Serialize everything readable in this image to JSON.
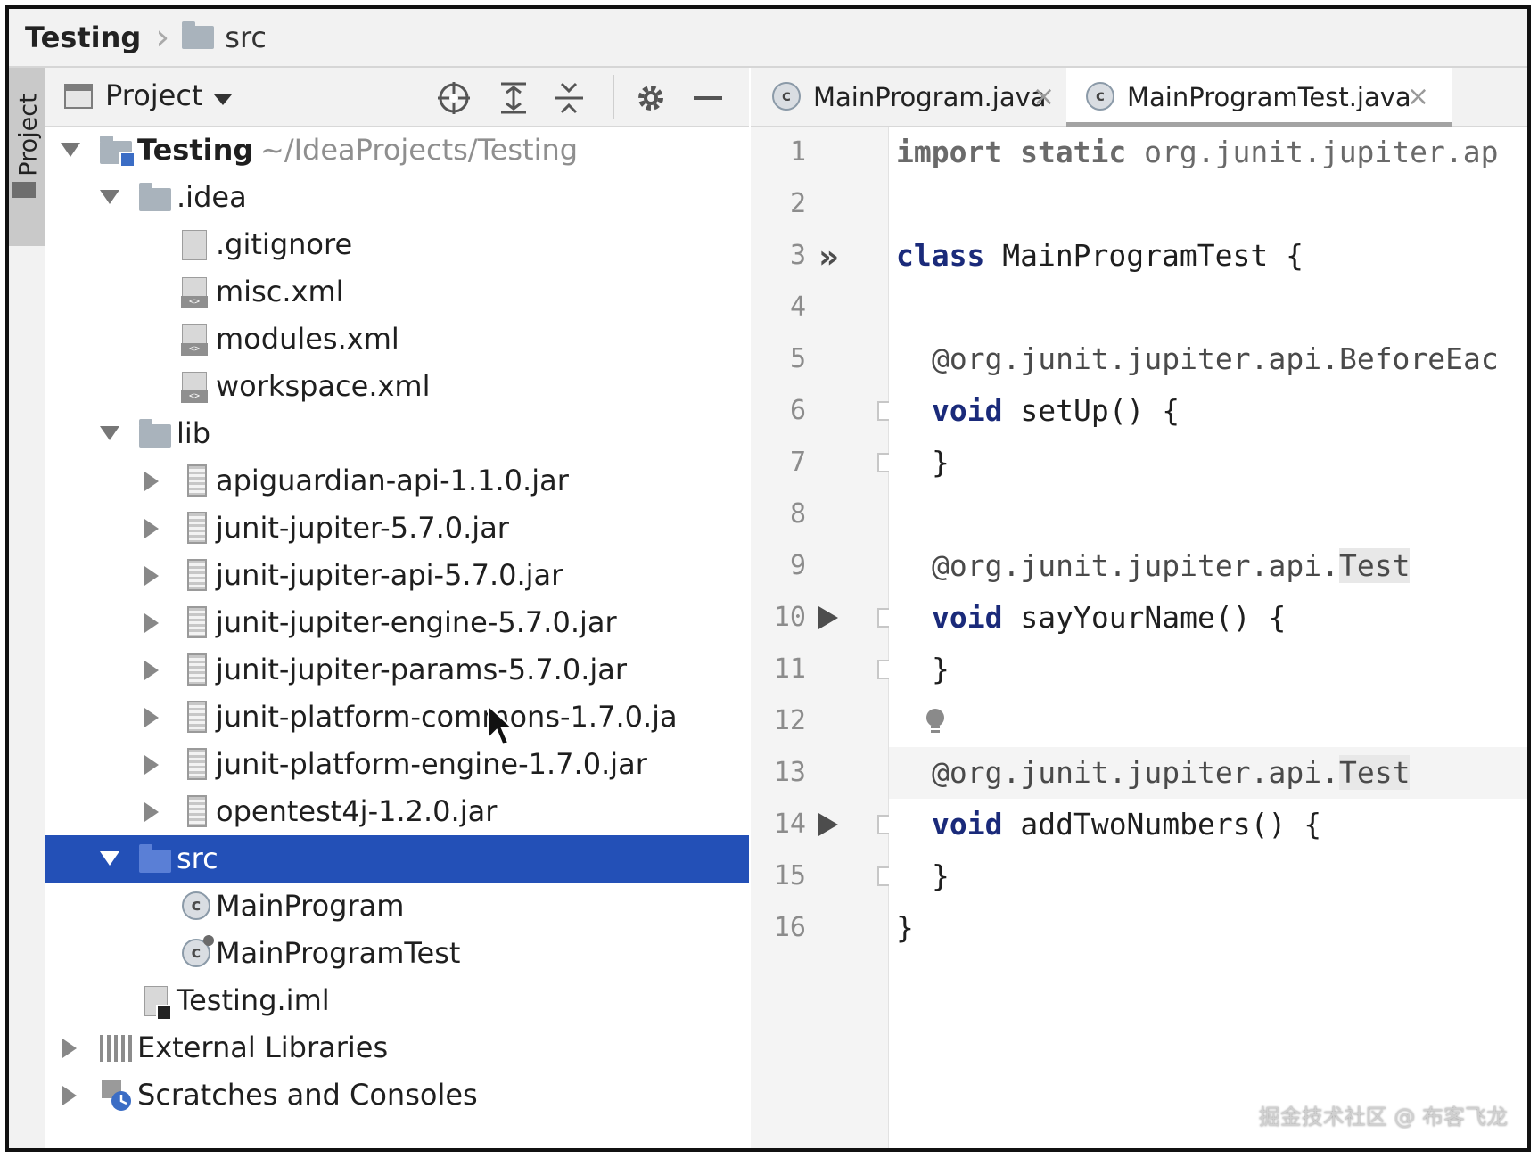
{
  "breadcrumb": {
    "root": "Testing",
    "current": "src"
  },
  "toolstrip": {
    "label": "Project"
  },
  "project_panel": {
    "title": "Project"
  },
  "tree": {
    "root": {
      "name": "Testing",
      "path": "~/IdeaProjects/Testing"
    },
    "idea": ".idea",
    "gitignore": ".gitignore",
    "misc": "misc.xml",
    "modules": "modules.xml",
    "workspace": "workspace.xml",
    "lib": "lib",
    "jars": [
      "apiguardian-api-1.1.0.jar",
      "junit-jupiter-5.7.0.jar",
      "junit-jupiter-api-5.7.0.jar",
      "junit-jupiter-engine-5.7.0.jar",
      "junit-jupiter-params-5.7.0.jar",
      "junit-platform-commons-1.7.0.ja",
      "junit-platform-engine-1.7.0.jar",
      "opentest4j-1.2.0.jar"
    ],
    "src": "src",
    "main_program": "MainProgram",
    "main_program_test": "MainProgramTest",
    "iml": "Testing.iml",
    "external_libraries": "External Libraries",
    "scratches": "Scratches and Consoles"
  },
  "editor": {
    "tabs": [
      {
        "label": "MainProgram.java",
        "active": false
      },
      {
        "label": "MainProgramTest.java",
        "active": true
      }
    ],
    "line_numbers": [
      "1",
      "2",
      "3",
      "4",
      "5",
      "6",
      "7",
      "8",
      "9",
      "10",
      "11",
      "12",
      "13",
      "14",
      "15",
      "16"
    ],
    "code": {
      "l1_kw": "import static",
      "l1_rest": " org.junit.jupiter.ap",
      "l3_kw": "class",
      "l3_rest": " MainProgramTest {",
      "l5": "@org.junit.jupiter.api.BeforeEac",
      "l6_kw": "void",
      "l6_rest": " setUp() {",
      "l7": "}",
      "l9_pre": "@org.junit.jupiter.api.",
      "l9_test": "Test",
      "l10_kw": "void",
      "l10_rest": " sayYourName() {",
      "l11": "}",
      "l13_pre": "@org.junit.jupiter.api.",
      "l13_test": "Test",
      "l14_kw": "void",
      "l14_rest": " addTwoNumbers() {",
      "l15": "}",
      "l16": "}"
    }
  },
  "watermark": "掘金技术社区 @ 布客飞龙",
  "colors": {
    "selection": "#2350b7",
    "keyword": "#1a2a7a"
  }
}
